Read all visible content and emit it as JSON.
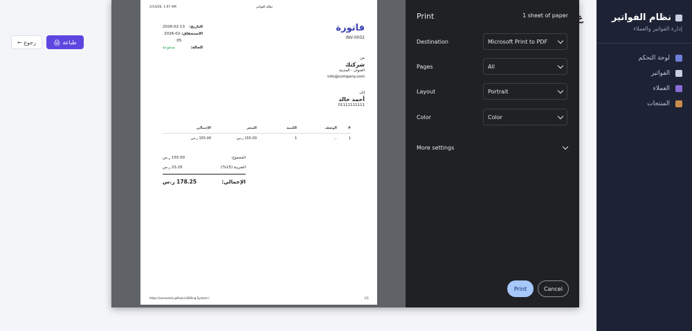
{
  "app": {
    "brand_title": "نظام الفواتير",
    "brand_subtitle": "إدارة الفواتير والعملاء",
    "heading_partial": "ع",
    "back_label": "← رجوع",
    "print_label": "طباعة",
    "nav": [
      {
        "label": "لوحة التحكم",
        "icon": "chart-icon",
        "color": "#6f7fd8"
      },
      {
        "label": "الفواتير",
        "icon": "document-icon",
        "color": "#c9cde0"
      },
      {
        "label": "العملاء",
        "icon": "users-icon",
        "color": "#8a6cd8"
      },
      {
        "label": "المنتجات",
        "icon": "box-icon",
        "color": "#c98b4a"
      }
    ]
  },
  "print_dialog": {
    "title": "Print",
    "sheets": "1 sheet of paper",
    "destination_label": "Destination",
    "destination_value": "Microsoft Print to PDF",
    "pages_label": "Pages",
    "pages_value": "All",
    "layout_label": "Layout",
    "layout_value": "Portrait",
    "color_label": "Color",
    "color_value": "Color",
    "more_settings": "More settings",
    "print_button": "Print",
    "cancel_button": "Cancel"
  },
  "paper": {
    "header_date": "2/14/26, 1:07 AM",
    "header_title": "نظام الفواتير",
    "invoice_title": "فاتورة",
    "invoice_number": "INV-0002",
    "date_label": "التاريخ:",
    "date_value": "2026-02-13",
    "due_label": "الاستحقاق:",
    "due_value": "2026-02-05",
    "status_label": "الحالة:",
    "status_value": "مدفوعة",
    "from_label": "من",
    "from_company": "شركتك",
    "from_address": "العنوان - المدينة",
    "from_email": "info@company.com",
    "to_label": "إلى",
    "to_name": "أحمد خالد",
    "to_phone": "01111111111",
    "columns": {
      "num": "#",
      "desc": "الوصف",
      "qty": "الكمية",
      "price": "السعر",
      "total": "الإجمالي"
    },
    "item": {
      "num": "1",
      "desc": "...",
      "qty": "1",
      "price": "155.00 ر.س",
      "total": "155.00 ر.س"
    },
    "subtotal_label": "المجموع:",
    "subtotal_value": "155.00 ر.س",
    "tax_label": "الضريبة (15%):",
    "tax_value": "23.25 ر.س",
    "grand_label": "الإجمالي:",
    "grand_value": "178.25 ر.س",
    "footer_url": "https://osmaalrsk.github.io/Billing-System-/",
    "footer_page": "1/1"
  }
}
